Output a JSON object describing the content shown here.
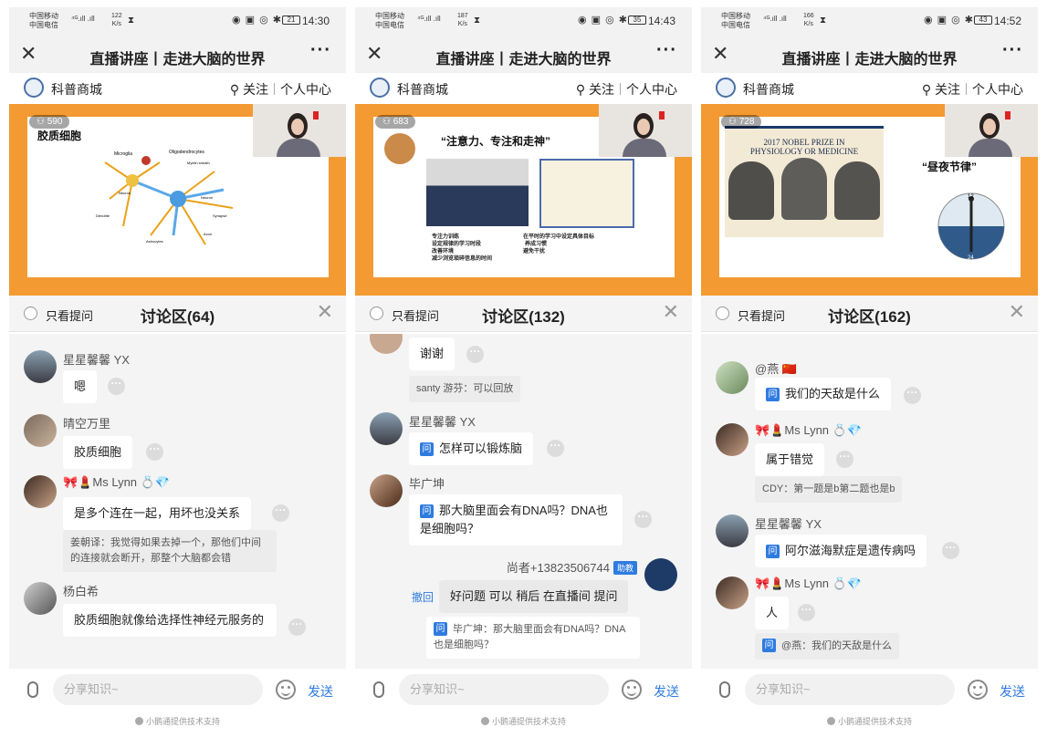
{
  "app": {
    "title": "直播讲座丨走进大脑的世界",
    "store_name": "科普商城",
    "follow": "关注",
    "personal_center": "个人中心",
    "only_questions": "只看提问",
    "input_placeholder": "分享知识~",
    "send": "发送",
    "powered_by": "小鹅通提供技术支持",
    "q_badge": "问"
  },
  "phones": [
    {
      "status": {
        "carrier1": "中国移动",
        "carrier2": "中国电信",
        "speed": "122",
        "speed_unit": "K/s",
        "battery": "21",
        "time": "14:30"
      },
      "views": "590",
      "discussion_title": "讨论区(64)",
      "slide": {
        "title": "胶质细胞",
        "labels": [
          "Microglia",
          "Oligodendrocytes",
          "Myelin sheath",
          "Neuron",
          "Dendrite",
          "Astrocytes",
          "Neuron",
          "Synapse",
          "Axon"
        ]
      },
      "messages": [
        {
          "user": "星星馨馨 YX",
          "text": "嗯"
        },
        {
          "user": "晴空万里",
          "text": "胶质细胞"
        },
        {
          "user": "Ms Lynn",
          "text": "是多个连在一起，用坏也没关系",
          "reply": "姜朝译：我觉得如果去掉一个，那他们中间的连接就会断开，那整个大脑都会错"
        },
        {
          "user": "杨白希",
          "text": "胶质细胞就像给选择性神经元服务的"
        }
      ]
    },
    {
      "status": {
        "carrier1": "中国移动",
        "carrier2": "中国电信",
        "speed": "187",
        "speed_unit": "K/s",
        "battery": "35",
        "time": "14:43"
      },
      "views": "683",
      "discussion_title": "讨论区(132)",
      "slide": {
        "title": "“注意力、专注和走神”",
        "left_lines": [
          "专注力训练",
          "设定规律的学习时段",
          "改善环境",
          "减少浏览琐碎信息的时间"
        ],
        "right_lines": [
          "在平时的学习中设定具体目标",
          "养成习惯",
          "避免干扰"
        ]
      },
      "messages": [
        {
          "text": "谢谢"
        },
        {
          "reply": "santy 游芬：可以回放"
        },
        {
          "user": "星星馨馨 YX",
          "text": "怎样可以锻炼脑",
          "question": true
        },
        {
          "user": "毕广坤",
          "text": "那大脑里面会有DNA吗？DNA也是细胞吗？",
          "question": true
        },
        {
          "user": "尚者+13823506744",
          "badge": "助教",
          "recall": "撤回",
          "text": "好问题 可以 稍后 在直播间 提问",
          "reply": "毕广坤：那大脑里面会有DNA吗？DNA也是细胞吗？"
        }
      ]
    },
    {
      "status": {
        "carrier1": "中国移动",
        "carrier2": "中国电信",
        "speed": "166",
        "speed_unit": "K/s",
        "battery": "43",
        "time": "14:52"
      },
      "views": "728",
      "discussion_title": "讨论区(162)",
      "slide": {
        "title": "“昼夜节律”",
        "nobel_line1": "2017 NOBEL PRIZE IN",
        "nobel_line2": "PHYSIOLOGY OR MEDICINE",
        "clock_top": "12",
        "clock_bottom": "24"
      },
      "messages": [
        {
          "user": "@燕",
          "text": "我们的天敌是什么",
          "question": true
        },
        {
          "user": "Ms Lynn",
          "text": "属于错觉",
          "reply": "CDY：第一题是b第二题也是b"
        },
        {
          "user": "星星馨馨 YX",
          "text": "阿尔滋海默症是遗传病吗",
          "question": true
        },
        {
          "user": "Ms Lynn",
          "text": "人",
          "reply": "@燕：我们的天敌是什么"
        }
      ]
    }
  ]
}
